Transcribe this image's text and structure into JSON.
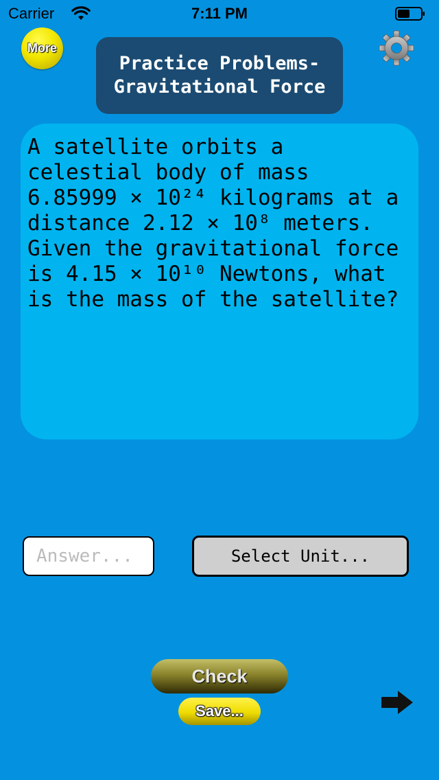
{
  "status_bar": {
    "carrier": "Carrier",
    "time": "7:11 PM"
  },
  "header": {
    "more_label": "More",
    "title_line1": "Practice Problems-",
    "title_line2": "Gravitational Force",
    "settings_icon": "gear-icon"
  },
  "question": {
    "text": "A satellite orbits a\ncelestial body of mass\n6.85999 × 10²⁴ kilograms at a\ndistance 2.12 × 10⁸ meters.\nGiven the gravitational force\nis 4.15 × 10¹⁰ Newtons, what\nis the mass of the satellite?"
  },
  "answer": {
    "placeholder": "Answer...",
    "value": ""
  },
  "unit_select": {
    "label": "Select Unit..."
  },
  "actions": {
    "check_label": "Check",
    "save_label": "Save...",
    "next_icon": "right-arrow-icon"
  },
  "colors": {
    "background": "#0492e0",
    "card": "#01b4ef",
    "title_box": "#1b4b72",
    "more_button": "#f1e600",
    "check_button": "#8a832c",
    "save_button": "#eedc00",
    "unit_button": "#cfcfcf"
  }
}
